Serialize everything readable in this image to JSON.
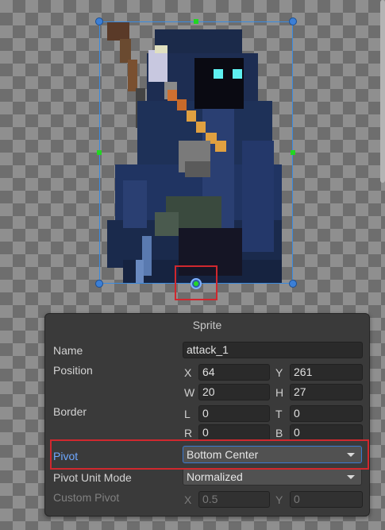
{
  "panel": {
    "title": "Sprite",
    "name_label": "Name",
    "name_value": "attack_1",
    "position_label": "Position",
    "position": {
      "x_label": "X",
      "x_value": "64",
      "y_label": "Y",
      "y_value": "261",
      "w_label": "W",
      "w_value": "20",
      "h_label": "H",
      "h_value": "27"
    },
    "border_label": "Border",
    "border": {
      "l_label": "L",
      "l_value": "0",
      "t_label": "T",
      "t_value": "0",
      "r_label": "R",
      "r_value": "0",
      "b_label": "B",
      "b_value": "0"
    },
    "pivot_label": "Pivot",
    "pivot_value": "Bottom Center",
    "pivot_unit_mode_label": "Pivot Unit Mode",
    "pivot_unit_mode_value": "Normalized",
    "custom_pivot_label": "Custom Pivot",
    "custom_pivot": {
      "x_label": "X",
      "x_value": "0.5",
      "y_label": "Y",
      "y_value": "0"
    }
  },
  "colors": {
    "accent": "#3a8be0",
    "highlight": "#d0282e",
    "pivot_label": "#6ea8ff",
    "handle_green": "#22d622"
  },
  "icons": {
    "dropdown": "chevron-down-icon",
    "pivot_handle": "pivot-handle-icon"
  }
}
